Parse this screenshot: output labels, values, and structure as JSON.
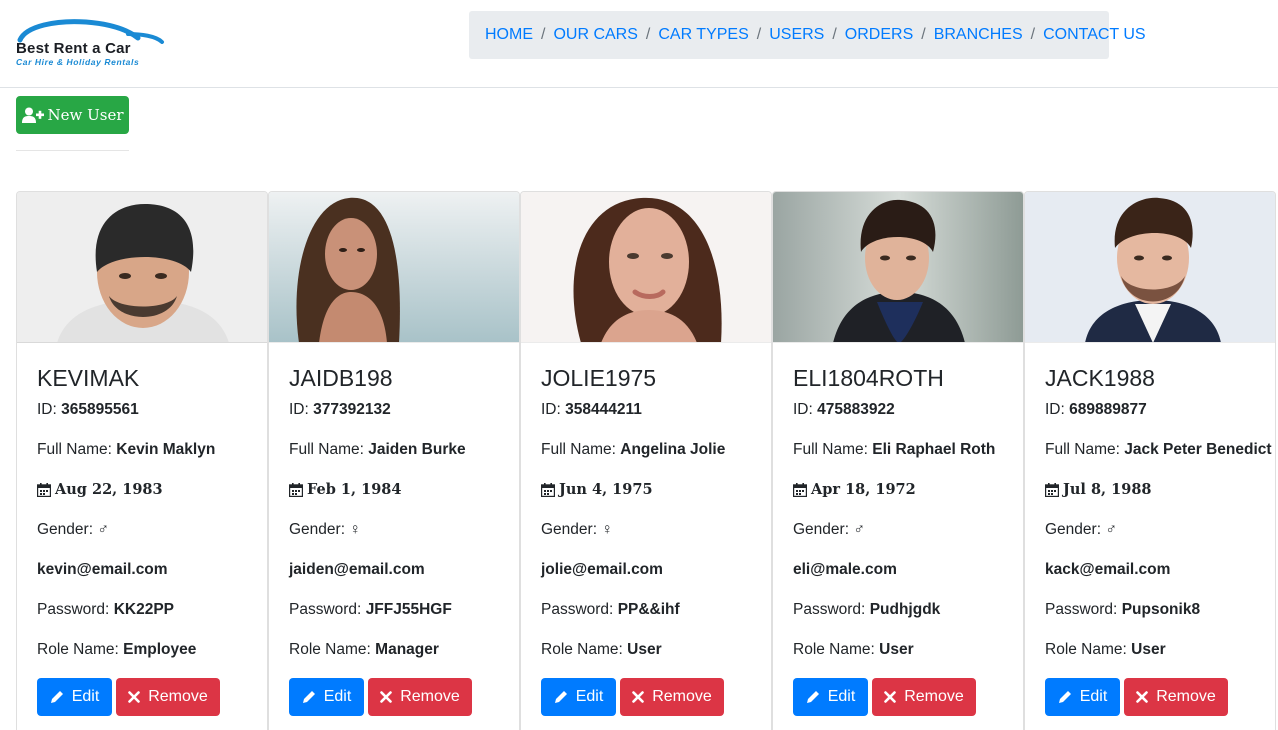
{
  "logo": {
    "title": "Best Rent a Car",
    "subtitle": "Car Hire & Holiday Rentals"
  },
  "nav": {
    "items": [
      "HOME",
      "OUR CARS",
      "CAR TYPES",
      "USERS",
      "ORDERS",
      "BRANCHES",
      "CONTACT US"
    ],
    "separator": "/"
  },
  "new_user_label": "New User",
  "labels": {
    "id": "ID:",
    "full_name": "Full Name:",
    "gender": "Gender:",
    "password": "Password:",
    "role_name": "Role Name:",
    "edit": "Edit",
    "remove": "Remove"
  },
  "users": [
    {
      "username": "KEVIMAK",
      "id": "365895561",
      "full_name": "Kevin Maklyn",
      "birth_date": "Aug 22, 1983",
      "gender_symbol": "♂",
      "email": "kevin@email.com",
      "password": "KK22PP",
      "role": "Employee"
    },
    {
      "username": "JAIDB198",
      "id": "377392132",
      "full_name": "Jaiden Burke",
      "birth_date": "Feb 1, 1984",
      "gender_symbol": "♀",
      "email": "jaiden@email.com",
      "password": "JFFJ55HGF",
      "role": "Manager"
    },
    {
      "username": "JOLIE1975",
      "id": "358444211",
      "full_name": "Angelina Jolie",
      "birth_date": "Jun 4, 1975",
      "gender_symbol": "♀",
      "email": "jolie@email.com",
      "password": "PP&&ihf",
      "role": "User"
    },
    {
      "username": "ELI1804ROTH",
      "id": "475883922",
      "full_name": "Eli Raphael Roth",
      "birth_date": "Apr 18, 1972",
      "gender_symbol": "♂",
      "email": "eli@male.com",
      "password": "Pudhjgdk",
      "role": "User"
    },
    {
      "username": "JACK1988",
      "id": "689889877",
      "full_name": "Jack Peter Benedict",
      "birth_date": "Jul 8, 1988",
      "gender_symbol": "♂",
      "email": "kack@email.com",
      "password": "Pupsonik8",
      "role": "User"
    }
  ],
  "colors": {
    "link": "#007bff",
    "success": "#28a745",
    "primary": "#007bff",
    "danger": "#dc3545",
    "navbar_bg": "#e9ecef"
  }
}
